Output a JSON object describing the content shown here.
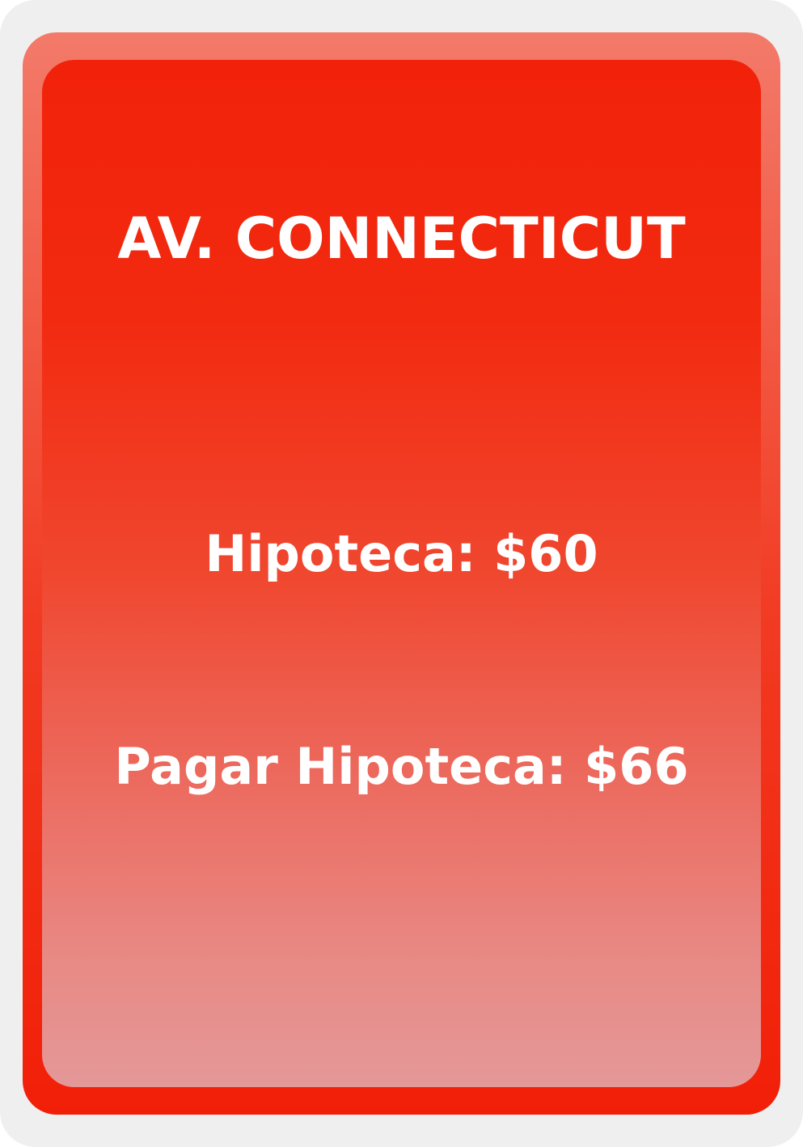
{
  "card": {
    "title": "AV. CONNECTICUT",
    "mortgage_label": "Hipoteca: $60",
    "unmortgage_label": "Pagar Hipoteca: $66",
    "colors": {
      "frame": "#efefef",
      "border_top": "#f37a6a",
      "border_bottom": "#f21f08",
      "inner_top": "#f2220a",
      "inner_bottom": "#e49898",
      "text": "#ffffff"
    }
  }
}
